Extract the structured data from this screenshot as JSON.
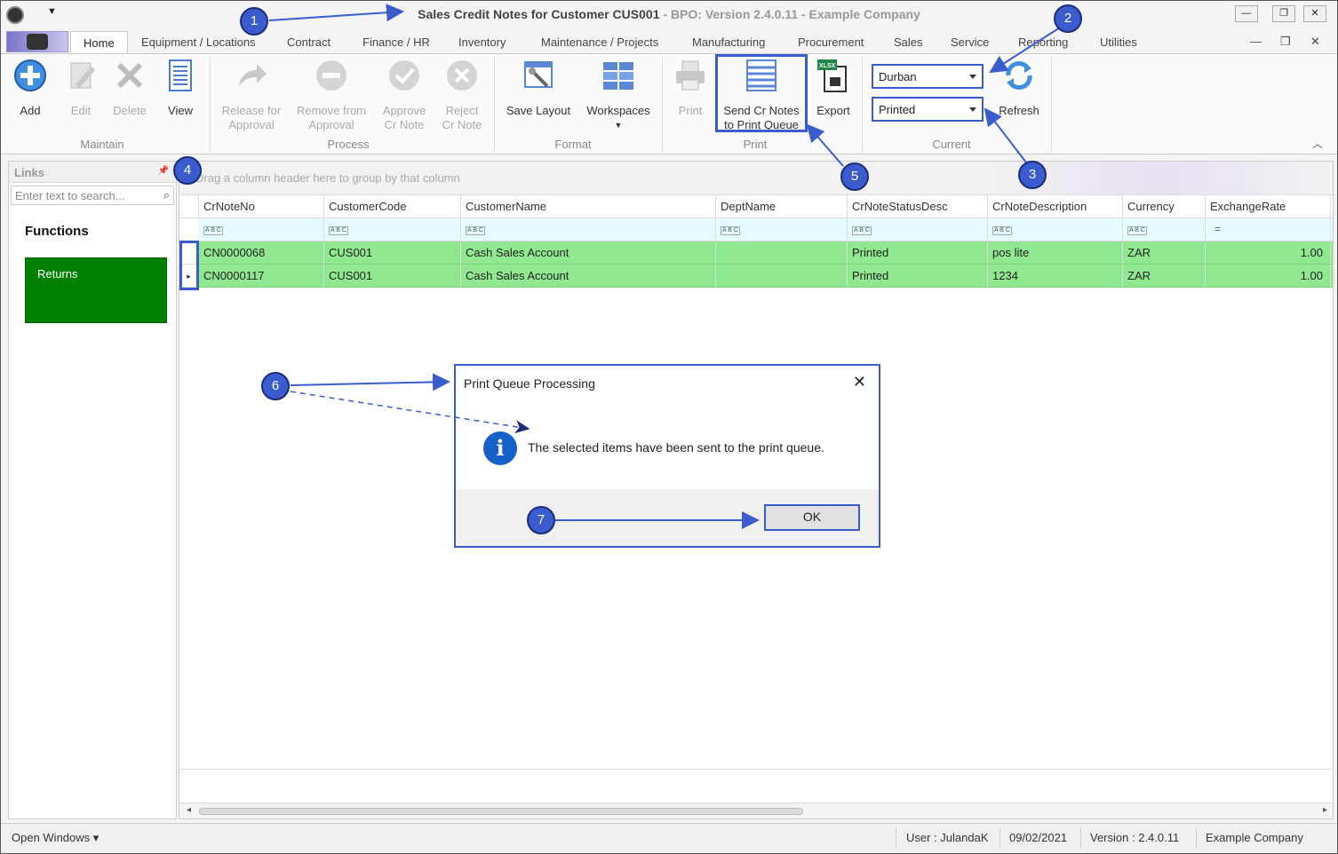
{
  "window": {
    "title_main": "Sales Credit Notes for Customer CUS001",
    "title_sub": "- BPO: Version 2.4.0.11 - Example Company",
    "minimize": "—",
    "restore": "❐",
    "close": "✕"
  },
  "tabs": [
    "Home",
    "Equipment / Locations",
    "Contract",
    "Finance / HR",
    "Inventory",
    "Maintenance / Projects",
    "Manufacturing",
    "Procurement",
    "Sales",
    "Service",
    "Reporting",
    "Utilities"
  ],
  "ribbon": {
    "maintain": {
      "label": "Maintain",
      "add": "Add",
      "edit": "Edit",
      "delete": "Delete",
      "view": "View"
    },
    "process": {
      "label": "Process",
      "release_1": "Release for",
      "release_2": "Approval",
      "remove_1": "Remove from",
      "remove_2": "Approval",
      "approve_1": "Approve",
      "approve_2": "Cr Note",
      "reject_1": "Reject",
      "reject_2": "Cr Note"
    },
    "format": {
      "label": "Format",
      "save_layout": "Save Layout",
      "workspaces": "Workspaces"
    },
    "print": {
      "label": "Print",
      "print": "Print",
      "send_1": "Send Cr Notes",
      "send_2": "to Print Queue",
      "export": "Export",
      "export_badge": "XLSX"
    },
    "current": {
      "label": "Current",
      "site": "Durban",
      "status": "Printed",
      "refresh": "Refresh"
    }
  },
  "links": {
    "title": "Links",
    "pin": "📌",
    "search_placeholder": "Enter text to search...",
    "search_icon": "⌕",
    "functions": "Functions",
    "tiles": [
      "Returns"
    ]
  },
  "grid": {
    "group_hint": "Drag a column header here to group by that column",
    "columns": [
      "CrNoteNo",
      "CustomerCode",
      "CustomerName",
      "DeptName",
      "CrNoteStatusDesc",
      "CrNoteDescription",
      "Currency",
      "ExchangeRate"
    ],
    "filter_tokens": [
      "A B C",
      "A B C",
      "A B C",
      "A B C",
      "A B C",
      "A B C",
      "A B C",
      "="
    ],
    "rows": [
      [
        "CN0000068",
        "CUS001",
        "Cash Sales Account",
        "",
        "Printed",
        "pos lite",
        "ZAR",
        "1.00"
      ],
      [
        "CN0000117",
        "CUS001",
        "Cash Sales Account",
        "",
        "Printed",
        "1234",
        "ZAR",
        "1.00"
      ]
    ],
    "current_row_marker": "▸"
  },
  "statusbar": {
    "open_windows": "Open Windows ▾",
    "user": "User : JulandaK",
    "date": "09/02/2021",
    "version": "Version : 2.4.0.11",
    "company": "Example Company"
  },
  "dialog": {
    "title": "Print Queue Processing",
    "close": "✕",
    "icon": "i",
    "message": "The selected items have been sent to the print queue.",
    "ok": "OK"
  },
  "annotations": [
    "1",
    "2",
    "3",
    "4",
    "5",
    "6",
    "7"
  ],
  "colors": {
    "accent": "#3b5ccf",
    "row_highlight": "#90e890",
    "tile_green": "#008000"
  }
}
